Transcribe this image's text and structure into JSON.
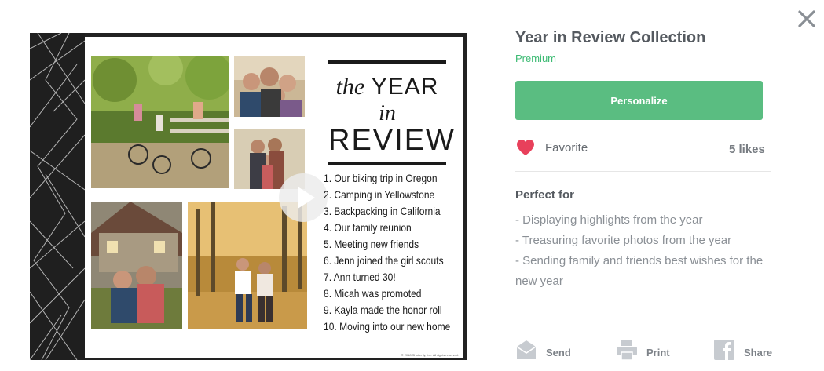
{
  "close": {
    "icon": "close-icon"
  },
  "product": {
    "title": "Year in Review Collection",
    "subtitle": "Premium",
    "personalize_label": "Personalize",
    "favorite_label": "Favorite",
    "likes": "5 likes"
  },
  "perfect_for": {
    "heading": "Perfect for",
    "items": [
      "- Displaying highlights from the year",
      "- Treasuring favorite photos from the year",
      "- Sending family and friends best wishes for the new year"
    ]
  },
  "card": {
    "title_the": "the",
    "title_year": "YEAR",
    "title_in": "in",
    "title_review": "REVIEW",
    "list": [
      "1. Our biking trip in Oregon",
      "2. Camping in Yellowstone",
      "3. Backpacking in California",
      "4. Our family reunion",
      "5. Meeting new friends",
      "6. Jenn joined the girl scouts",
      "7. Ann turned 30!",
      "8. Micah was promoted",
      "9. Kayla made the honor roll",
      "10. Moving into our new home"
    ],
    "copyright": "© 2018 Shutterfly, Inc. All rights reserved."
  },
  "actions": {
    "send": "Send",
    "print": "Print",
    "share": "Share"
  },
  "colors": {
    "accent_green": "#5abd81",
    "premium_green": "#3dbb74",
    "heart_red": "#e8405b"
  }
}
